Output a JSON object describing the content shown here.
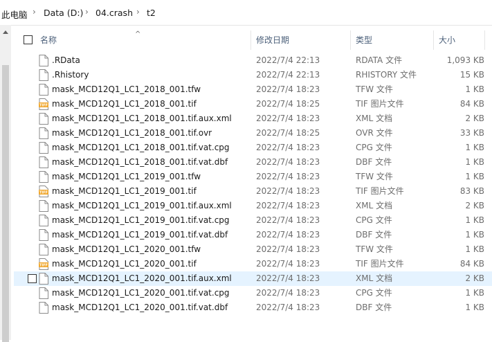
{
  "breadcrumb": [
    "此电脑",
    "Data (D:)",
    "04.crash",
    "t2"
  ],
  "columns": {
    "name": "名称",
    "date": "修改日期",
    "type": "类型",
    "size": "大小"
  },
  "icons": {
    "doc": "document-icon",
    "tif": "tif-image-icon",
    "tif_badge": "TIFF"
  },
  "files": [
    {
      "name": ".RData",
      "date": "2022/7/4 22:13",
      "type": "RDATA 文件",
      "size": "1,093 KB",
      "icon": "doc"
    },
    {
      "name": ".Rhistory",
      "date": "2022/7/4 22:13",
      "type": "RHISTORY 文件",
      "size": "15 KB",
      "icon": "doc"
    },
    {
      "name": "mask_MCD12Q1_LC1_2018_001.tfw",
      "date": "2022/7/4 18:23",
      "type": "TFW 文件",
      "size": "1 KB",
      "icon": "doc"
    },
    {
      "name": "mask_MCD12Q1_LC1_2018_001.tif",
      "date": "2022/7/4 18:25",
      "type": "TIF 图片文件",
      "size": "84 KB",
      "icon": "tif"
    },
    {
      "name": "mask_MCD12Q1_LC1_2018_001.tif.aux.xml",
      "date": "2022/7/4 18:23",
      "type": "XML 文档",
      "size": "2 KB",
      "icon": "doc"
    },
    {
      "name": "mask_MCD12Q1_LC1_2018_001.tif.ovr",
      "date": "2022/7/4 18:25",
      "type": "OVR 文件",
      "size": "33 KB",
      "icon": "doc"
    },
    {
      "name": "mask_MCD12Q1_LC1_2018_001.tif.vat.cpg",
      "date": "2022/7/4 18:23",
      "type": "CPG 文件",
      "size": "1 KB",
      "icon": "doc"
    },
    {
      "name": "mask_MCD12Q1_LC1_2018_001.tif.vat.dbf",
      "date": "2022/7/4 18:23",
      "type": "DBF 文件",
      "size": "1 KB",
      "icon": "doc"
    },
    {
      "name": "mask_MCD12Q1_LC1_2019_001.tfw",
      "date": "2022/7/4 18:23",
      "type": "TFW 文件",
      "size": "1 KB",
      "icon": "doc"
    },
    {
      "name": "mask_MCD12Q1_LC1_2019_001.tif",
      "date": "2022/7/4 18:23",
      "type": "TIF 图片文件",
      "size": "83 KB",
      "icon": "tif"
    },
    {
      "name": "mask_MCD12Q1_LC1_2019_001.tif.aux.xml",
      "date": "2022/7/4 18:23",
      "type": "XML 文档",
      "size": "2 KB",
      "icon": "doc"
    },
    {
      "name": "mask_MCD12Q1_LC1_2019_001.tif.vat.cpg",
      "date": "2022/7/4 18:23",
      "type": "CPG 文件",
      "size": "1 KB",
      "icon": "doc"
    },
    {
      "name": "mask_MCD12Q1_LC1_2019_001.tif.vat.dbf",
      "date": "2022/7/4 18:23",
      "type": "DBF 文件",
      "size": "1 KB",
      "icon": "doc"
    },
    {
      "name": "mask_MCD12Q1_LC1_2020_001.tfw",
      "date": "2022/7/4 18:23",
      "type": "TFW 文件",
      "size": "1 KB",
      "icon": "doc"
    },
    {
      "name": "mask_MCD12Q1_LC1_2020_001.tif",
      "date": "2022/7/4 18:23",
      "type": "TIF 图片文件",
      "size": "84 KB",
      "icon": "tif"
    },
    {
      "name": "mask_MCD12Q1_LC1_2020_001.tif.aux.xml",
      "date": "2022/7/4 18:23",
      "type": "XML 文档",
      "size": "2 KB",
      "icon": "doc",
      "selected": true
    },
    {
      "name": "mask_MCD12Q1_LC1_2020_001.tif.vat.cpg",
      "date": "2022/7/4 18:23",
      "type": "CPG 文件",
      "size": "1 KB",
      "icon": "doc"
    },
    {
      "name": "mask_MCD12Q1_LC1_2020_001.tif.vat.dbf",
      "date": "2022/7/4 18:23",
      "type": "DBF 文件",
      "size": "1 KB",
      "icon": "doc"
    }
  ],
  "colors": {
    "selected_row": "#e5f3ff",
    "header_text": "#4c607a",
    "secondary_text": "#6d6d6d",
    "tif_icon": "#f0a830"
  }
}
